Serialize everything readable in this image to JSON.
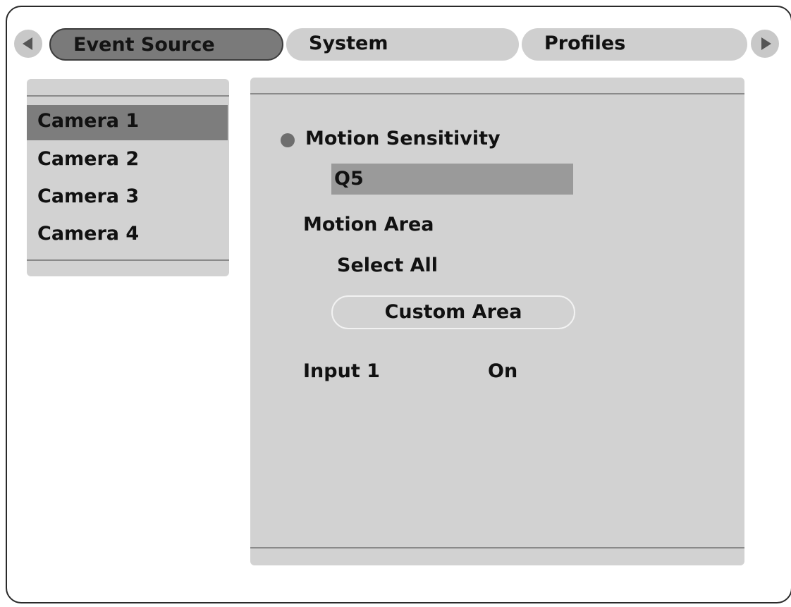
{
  "tabs": {
    "items": [
      {
        "label": "Event Source",
        "active": true
      },
      {
        "label": "System",
        "active": false
      },
      {
        "label": "Profiles",
        "active": false
      }
    ],
    "prev_icon": "triangle-left-icon",
    "next_icon": "triangle-right-icon"
  },
  "cameras": {
    "items": [
      {
        "label": "Camera 1",
        "selected": true
      },
      {
        "label": "Camera 2",
        "selected": false
      },
      {
        "label": "Camera 3",
        "selected": false
      },
      {
        "label": "Camera 4",
        "selected": false
      }
    ]
  },
  "settings": {
    "motion_sensitivity_label": "Motion Sensitivity",
    "motion_sensitivity_value": "Q5",
    "motion_area_label": "Motion Area",
    "select_all_label": "Select All",
    "custom_area_label": "Custom Area",
    "input_label": "Input 1",
    "input_value": "On"
  },
  "colors": {
    "active_tab": "#7a7a7a",
    "inactive_tab": "#cfcfcf",
    "panel": "#d2d2d2",
    "selected_item": "#7d7d7d",
    "value_field": "#9a9a9a"
  }
}
